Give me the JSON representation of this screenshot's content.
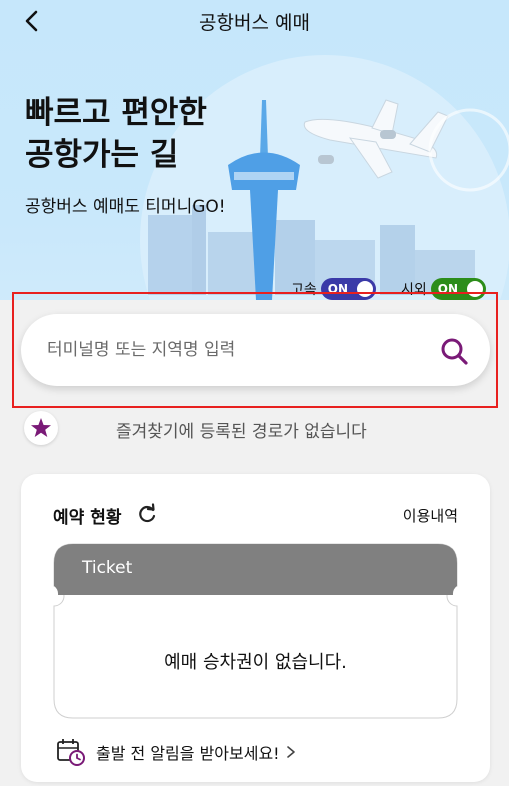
{
  "header": {
    "title": "공항버스 예매",
    "back_icon": "chevron-left-icon"
  },
  "hero": {
    "title_line1": "빠르고 편안한",
    "title_line2": "공항가는 길",
    "subtitle": "공항버스 예매도 티머니GO!"
  },
  "toggles": [
    {
      "label": "고속",
      "state": "ON",
      "color": "#3a3aa8"
    },
    {
      "label": "시외",
      "state": "ON",
      "color": "#2c8d1a"
    }
  ],
  "search": {
    "placeholder": "터미널명 또는 지역명 입력",
    "icon": "search-icon",
    "icon_color": "#7a1a77"
  },
  "favorites": {
    "icon": "star-icon",
    "empty_text": "즐겨찾기에 등록된 경로가 없습니다"
  },
  "reservation": {
    "title": "예약 현황",
    "refresh_icon": "refresh-icon",
    "history_label": "이용내역",
    "ticket_label": "Ticket",
    "empty_text": "예매 승차권이 없습니다.",
    "alarm_text": "출발 전 알림을 받아보세요!",
    "alarm_icon": "calendar-clock-icon"
  },
  "colors": {
    "sky": "#c6e7fb",
    "brand_purple": "#7a1a77",
    "highlight_red": "#e8201f",
    "ticket_gray": "#808080"
  }
}
